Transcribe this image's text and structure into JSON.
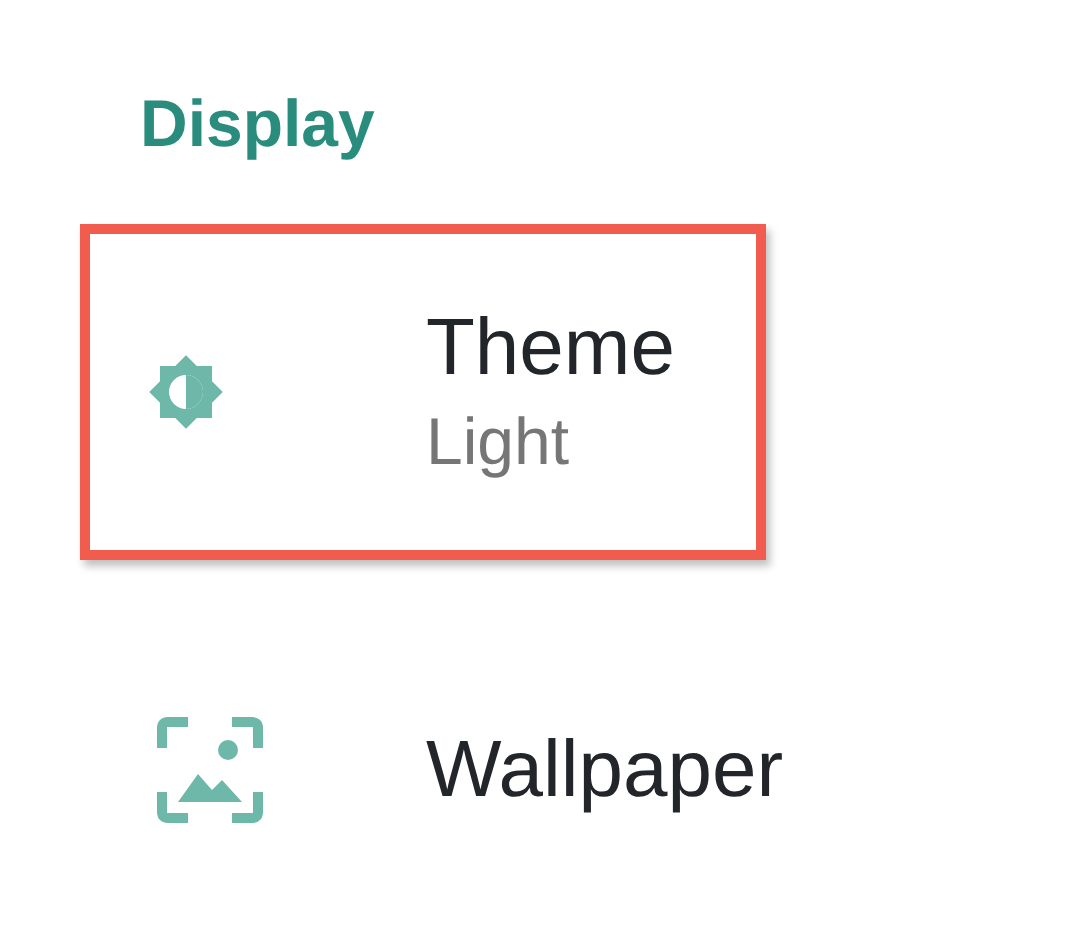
{
  "section": {
    "title": "Display"
  },
  "items": [
    {
      "kind": "theme",
      "title": "Theme",
      "summary": "Light",
      "highlighted": true
    },
    {
      "kind": "wallpaper",
      "title": "Wallpaper",
      "highlighted": false
    }
  ]
}
